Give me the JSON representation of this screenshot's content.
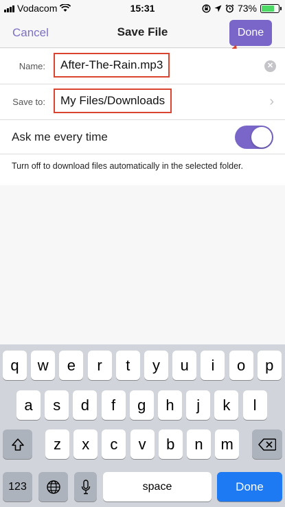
{
  "status_bar": {
    "carrier": "Vodacom",
    "time": "15:31",
    "battery": "73%",
    "battery_level": 0.73
  },
  "nav": {
    "cancel_label": "Cancel",
    "title": "Save File",
    "done_label": "Done"
  },
  "form": {
    "name_label": "Name:",
    "name_value": "After-The-Rain.mp3",
    "save_to_label": "Save to:",
    "save_to_value": "My Files/Downloads",
    "ask_label": "Ask me every time",
    "ask_enabled": true,
    "description": "Turn off to download files automatically in the selected folder."
  },
  "keyboard": {
    "row1": [
      "q",
      "w",
      "e",
      "r",
      "t",
      "y",
      "u",
      "i",
      "o",
      "p"
    ],
    "row2": [
      "a",
      "s",
      "d",
      "f",
      "g",
      "h",
      "j",
      "k",
      "l"
    ],
    "row3": [
      "z",
      "x",
      "c",
      "v",
      "b",
      "n",
      "m"
    ],
    "numbers_label": "123",
    "space_label": "space",
    "done_label": "Done"
  },
  "colors": {
    "accent": "#7a66c8",
    "highlight": "#d9432f",
    "keyboard_done": "#1d7af2"
  },
  "icons": [
    "signal-icon",
    "wifi-icon",
    "rotation-lock-icon",
    "location-icon",
    "alarm-icon",
    "battery-icon",
    "clear-icon",
    "chevron-right-icon",
    "shift-icon",
    "backspace-icon",
    "globe-icon",
    "microphone-icon",
    "annotation-arrow-icon"
  ]
}
